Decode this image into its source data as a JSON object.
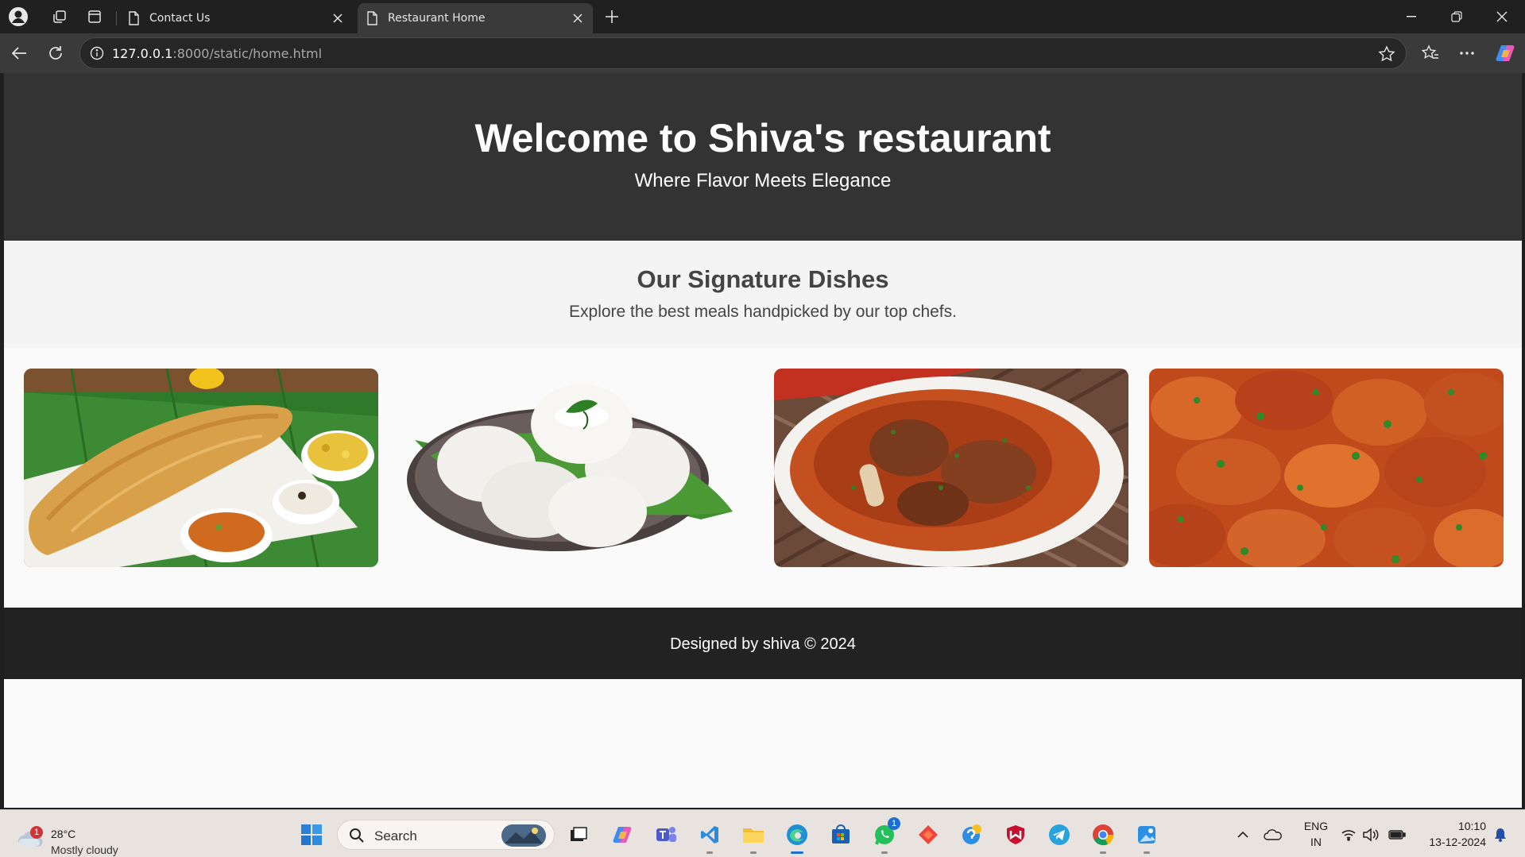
{
  "browser": {
    "tabs": [
      {
        "title": "Contact Us",
        "active": false
      },
      {
        "title": "Restaurant Home",
        "active": true
      }
    ],
    "url_host": "127.0.0.1",
    "url_rest": ":8000/static/home.html"
  },
  "page": {
    "hero": {
      "title": "Welcome to Shiva's restaurant",
      "tagline": "Where Flavor Meets Elegance"
    },
    "signature": {
      "heading": "Our Signature Dishes",
      "subtitle": "Explore the best meals handpicked by our top chefs."
    },
    "dishes": [
      {
        "icon": "dosa-image"
      },
      {
        "icon": "idli-image"
      },
      {
        "icon": "mutton-curry-image"
      },
      {
        "icon": "chicken-curry-image"
      }
    ],
    "footer": {
      "text": "Designed by shiva © 2024"
    }
  },
  "taskbar": {
    "weather": {
      "temp": "28°C",
      "condition": "Mostly cloudy",
      "badge": "1"
    },
    "search_label": "Search",
    "whatsapp_badge": "1",
    "lang_top": "ENG",
    "lang_bottom": "IN",
    "time": "10:10",
    "date": "13-12-2024"
  },
  "colors": {
    "hero_bg": "#333333",
    "signature_bg": "#f4f4f4",
    "footer_bg": "#222222",
    "browser_chrome": "#202020"
  }
}
